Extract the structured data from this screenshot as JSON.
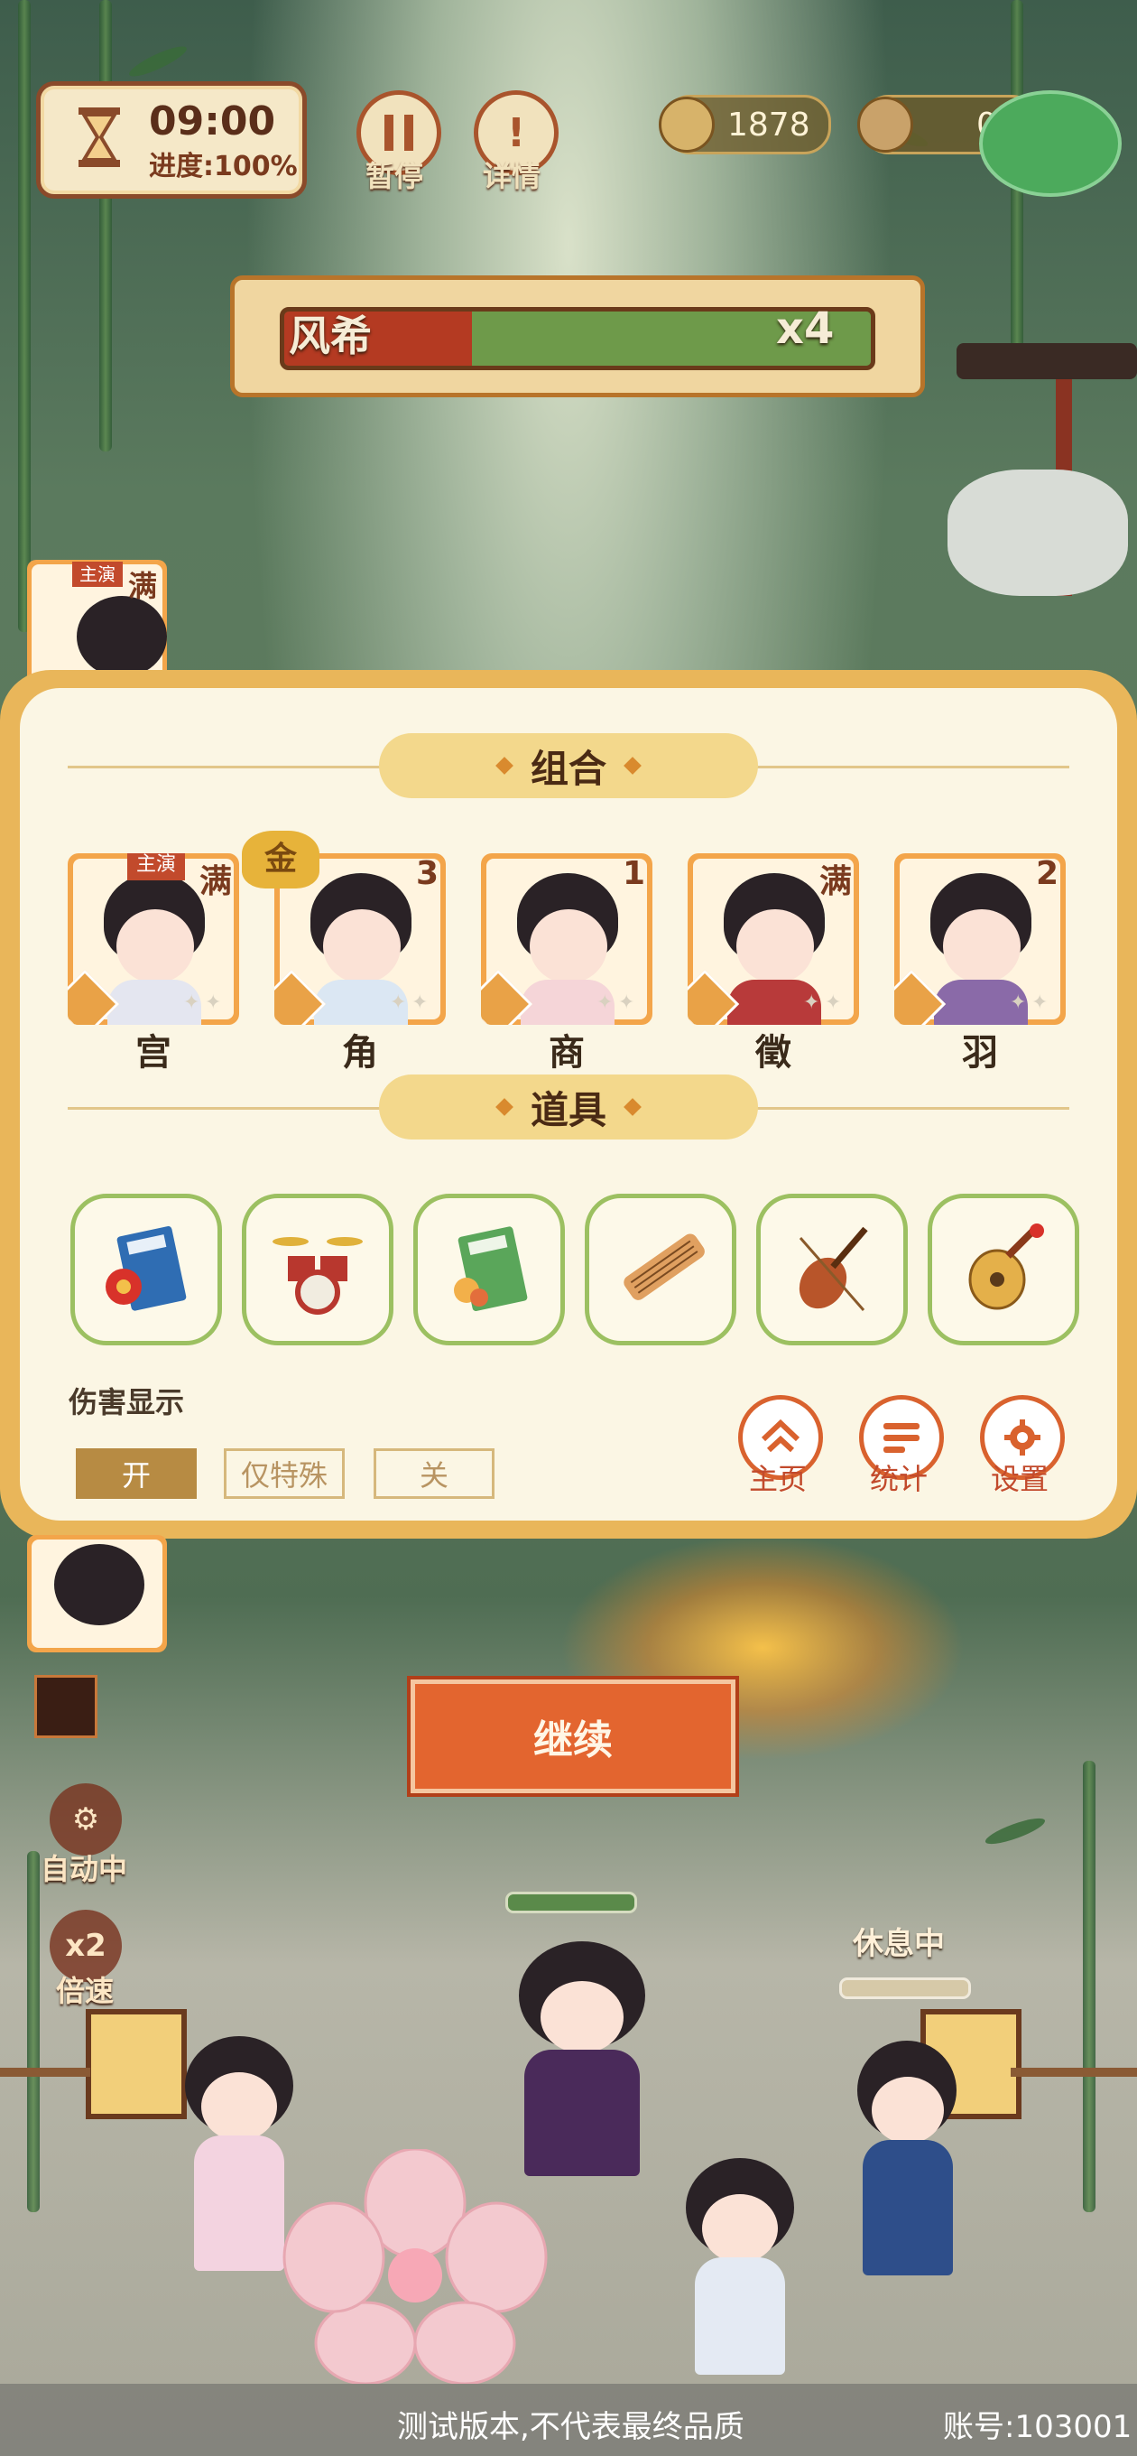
{
  "hud": {
    "time": "09:00",
    "progress": "进度:100%",
    "pause_label": "暂停",
    "pause_icon": "pause-icon",
    "details_label": "详情",
    "details_icon": "exclamation-icon",
    "currency_value": "1878",
    "coin_value": "0"
  },
  "boss": {
    "name": "风希",
    "multiplier": "x4",
    "health_fraction": 0.32,
    "colors": {
      "health": "#b43a22",
      "bar": "#6e9a4a"
    }
  },
  "panel": {
    "combo_title": "组合",
    "lead_tag": "主演",
    "gold_badge": "金",
    "characters": [
      {
        "name": "宫",
        "count": "满"
      },
      {
        "name": "角",
        "count": "3"
      },
      {
        "name": "商",
        "count": "1"
      },
      {
        "name": "徵",
        "count": "满"
      },
      {
        "name": "羽",
        "count": "2"
      }
    ],
    "items_title": "道具",
    "items": [
      {
        "icon": "book-flower-icon"
      },
      {
        "icon": "drum-kit-icon"
      },
      {
        "icon": "green-book-icon"
      },
      {
        "icon": "guzheng-icon"
      },
      {
        "icon": "violin-icon"
      },
      {
        "icon": "pipa-icon"
      }
    ],
    "damage_label": "伤害显示",
    "damage_options": [
      "开",
      "仅特殊",
      "关"
    ],
    "damage_selected": "开",
    "menu": [
      {
        "label": "主页",
        "icon": "home-icon"
      },
      {
        "label": "统计",
        "icon": "stats-icon"
      },
      {
        "label": "设置",
        "icon": "gear-icon"
      }
    ]
  },
  "side": {
    "left_card_count": "满",
    "left_card_tag": "主演",
    "auto_label": "自动中",
    "speed_value": "x2",
    "speed_label": "倍速"
  },
  "continue_label": "继续",
  "resting_label": "休息中",
  "footer": {
    "notice": "测试版本,不代表最终品质",
    "account": "账号:103001"
  }
}
